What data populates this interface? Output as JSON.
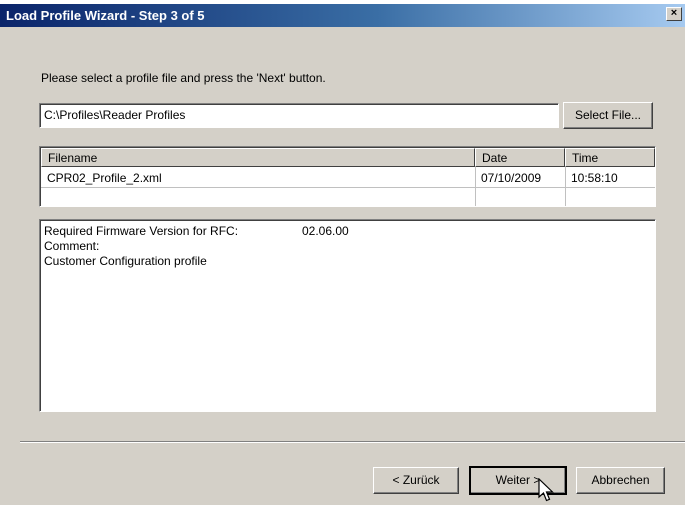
{
  "window": {
    "title": "Load Profile Wizard - Step 3 of 5",
    "close_glyph": "×"
  },
  "instruction": "Please select a profile file and press the 'Next' button.",
  "path_field": {
    "value": "C:\\Profiles\\Reader Profiles"
  },
  "select_file_label": "Select File...",
  "file_list": {
    "columns": [
      "Filename",
      "Date",
      "Time"
    ],
    "rows": [
      {
        "filename": "CPR02_Profile_2.xml",
        "date": "07/10/2009",
        "time": "10:58:10"
      }
    ]
  },
  "details": {
    "firmware_label": "Required Firmware Version for RFC:",
    "firmware_value": "02.06.00",
    "comment_label": "Comment:",
    "comment_text": "Customer Configuration profile"
  },
  "buttons": {
    "back": "< Zurück",
    "next": "Weiter >",
    "cancel": "Abbrechen"
  },
  "icons": {
    "cursor": "mouse-pointer-icon"
  }
}
